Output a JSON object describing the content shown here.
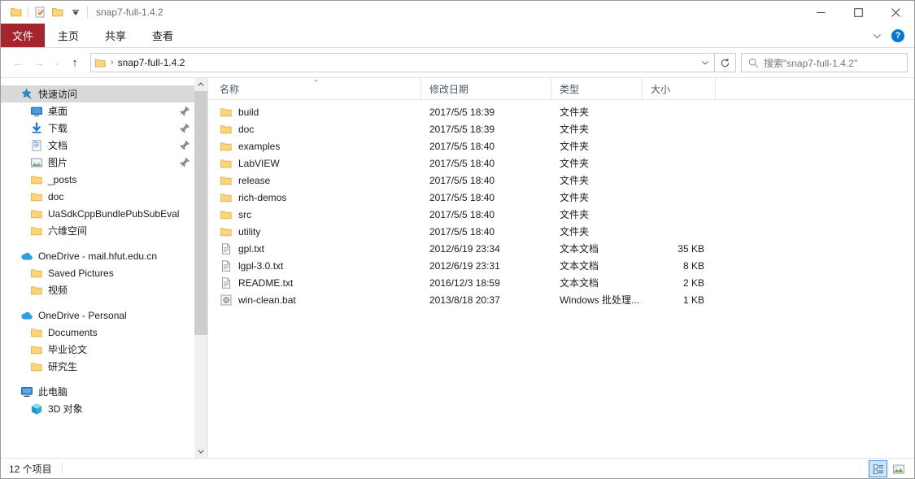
{
  "window": {
    "title": "snap7-full-1.4.2",
    "quick_access": [
      "folder-icon",
      "properties-icon",
      "new-folder-icon",
      "customize-dropdown-icon"
    ],
    "controls": {
      "minimize": "–",
      "maximize": "☐",
      "close": "✕"
    }
  },
  "ribbon": {
    "file_tab": "文件",
    "tabs": [
      "主页",
      "共享",
      "查看"
    ],
    "collapse_icon": "chevron-down-icon",
    "help_label": "?"
  },
  "nav": {
    "back": "←",
    "forward": "→",
    "recent": "⌄",
    "up": "↑",
    "breadcrumb_sep": "›",
    "breadcrumb": "snap7-full-1.4.2",
    "address_dropdown": "⌄",
    "refresh": "↻"
  },
  "search": {
    "placeholder": "搜索\"snap7-full-1.4.2\"",
    "icon": "search-icon"
  },
  "sidebar": {
    "groups": [
      {
        "header": {
          "label": "快速访问",
          "icon": "star-pin-icon",
          "selected": true,
          "indent": 0
        },
        "items": [
          {
            "label": "桌面",
            "icon": "desktop-icon",
            "pinned": true,
            "indent": 1
          },
          {
            "label": "下载",
            "icon": "download-icon",
            "pinned": true,
            "indent": 1
          },
          {
            "label": "文档",
            "icon": "documents-icon",
            "pinned": true,
            "indent": 1
          },
          {
            "label": "图片",
            "icon": "pictures-icon",
            "pinned": true,
            "indent": 1
          },
          {
            "label": "_posts",
            "icon": "folder-icon",
            "pinned": false,
            "indent": 1
          },
          {
            "label": "doc",
            "icon": "folder-icon",
            "pinned": false,
            "indent": 1
          },
          {
            "label": "UaSdkCppBundlePubSubEval",
            "icon": "folder-icon",
            "pinned": false,
            "indent": 1
          },
          {
            "label": "六维空间",
            "icon": "folder-icon",
            "pinned": false,
            "indent": 1
          }
        ]
      },
      {
        "header": {
          "label": "OneDrive - mail.hfut.edu.cn",
          "icon": "onedrive-icon",
          "selected": false,
          "indent": 0
        },
        "items": [
          {
            "label": "Saved Pictures",
            "icon": "folder-icon",
            "pinned": false,
            "indent": 1
          },
          {
            "label": "视频",
            "icon": "folder-icon",
            "pinned": false,
            "indent": 1
          }
        ]
      },
      {
        "header": {
          "label": "OneDrive - Personal",
          "icon": "onedrive-icon",
          "selected": false,
          "indent": 0
        },
        "items": [
          {
            "label": "Documents",
            "icon": "folder-icon",
            "pinned": false,
            "indent": 1
          },
          {
            "label": "毕业论文",
            "icon": "folder-icon",
            "pinned": false,
            "indent": 1
          },
          {
            "label": "研究生",
            "icon": "folder-icon",
            "pinned": false,
            "indent": 1
          }
        ]
      },
      {
        "header": {
          "label": "此电脑",
          "icon": "this-pc-icon",
          "selected": false,
          "indent": 0
        },
        "items": [
          {
            "label": "3D 对象",
            "icon": "3d-objects-icon",
            "pinned": false,
            "indent": 1
          }
        ]
      }
    ]
  },
  "filelist": {
    "columns": [
      {
        "key": "name",
        "label": "名称",
        "sorted": "asc"
      },
      {
        "key": "date",
        "label": "修改日期",
        "sorted": ""
      },
      {
        "key": "type",
        "label": "类型",
        "sorted": ""
      },
      {
        "key": "size",
        "label": "大小",
        "sorted": ""
      }
    ],
    "sort_caret": "⌃",
    "rows": [
      {
        "name": "build",
        "icon": "folder-icon",
        "date": "2017/5/5 18:39",
        "type": "文件夹",
        "size": ""
      },
      {
        "name": "doc",
        "icon": "folder-icon",
        "date": "2017/5/5 18:39",
        "type": "文件夹",
        "size": ""
      },
      {
        "name": "examples",
        "icon": "folder-icon",
        "date": "2017/5/5 18:40",
        "type": "文件夹",
        "size": ""
      },
      {
        "name": "LabVIEW",
        "icon": "folder-icon",
        "date": "2017/5/5 18:40",
        "type": "文件夹",
        "size": ""
      },
      {
        "name": "release",
        "icon": "folder-icon",
        "date": "2017/5/5 18:40",
        "type": "文件夹",
        "size": ""
      },
      {
        "name": "rich-demos",
        "icon": "folder-icon",
        "date": "2017/5/5 18:40",
        "type": "文件夹",
        "size": ""
      },
      {
        "name": "src",
        "icon": "folder-icon",
        "date": "2017/5/5 18:40",
        "type": "文件夹",
        "size": ""
      },
      {
        "name": "utility",
        "icon": "folder-icon",
        "date": "2017/5/5 18:40",
        "type": "文件夹",
        "size": ""
      },
      {
        "name": "gpl.txt",
        "icon": "text-file-icon",
        "date": "2012/6/19 23:34",
        "type": "文本文档",
        "size": "35 KB"
      },
      {
        "name": "lgpl-3.0.txt",
        "icon": "text-file-icon",
        "date": "2012/6/19 23:31",
        "type": "文本文档",
        "size": "8 KB"
      },
      {
        "name": "README.txt",
        "icon": "text-file-icon",
        "date": "2016/12/3 18:59",
        "type": "文本文档",
        "size": "2 KB"
      },
      {
        "name": "win-clean.bat",
        "icon": "batch-file-icon",
        "date": "2013/8/18 20:37",
        "type": "Windows 批处理...",
        "size": "1 KB"
      }
    ]
  },
  "statusbar": {
    "item_count": "12 个项目",
    "views": [
      {
        "name": "details-view-button",
        "active": true
      },
      {
        "name": "large-icons-view-button",
        "active": false
      }
    ]
  },
  "colors": {
    "file_tab_red": "#a4262c",
    "folder_yellow": "#fcd579",
    "accent_blue": "#0078d7",
    "selection_grey": "#d9d9d9"
  }
}
